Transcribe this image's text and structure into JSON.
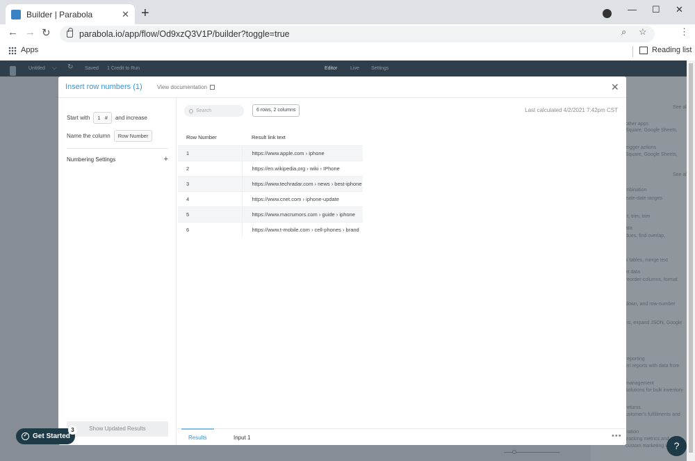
{
  "browser": {
    "tab_title": "Builder | Parabola",
    "tab_close": "✕",
    "new_tab": "+",
    "url": "parabola.io/app/flow/Od9xzQ3V1P/builder?toggle=true",
    "bookmarks": {
      "apps": "Apps",
      "reading_list": "Reading list"
    }
  },
  "appbar": {
    "flow_name": "Untitled",
    "saved": "Saved",
    "credits": "1 Credit to Run",
    "tabs": [
      "Editor",
      "Live",
      "Settings"
    ]
  },
  "side_panel": {
    "items": [
      "See all",
      "other apps",
      "Square, Google Sheets,",
      "trigger actions",
      "Square, Google Sheets,",
      "See all",
      "mbination",
      "eate-date ranges",
      "rt, trim, trim",
      "ata",
      "dues, find overlap,",
      "k tables, merge text",
      "xt data",
      "reorder-columns, format",
      "down, and row-number",
      "ns, expand JSON, Google",
      "reporting",
      "en reports with data from",
      "management",
      "solutions for bulk inventory",
      "returns",
      "ustomer's fulfillments and",
      "nation",
      "tracking metrics and",
      "custom marketing workflows"
    ]
  },
  "modal": {
    "title": "Insert row numbers (1)",
    "view_doc": "View documentation",
    "close": "✕",
    "settings": {
      "start_with_label": "Start with",
      "start_value": "1",
      "start_hash": "#",
      "and_increase": "and increase",
      "name_column_label": "Name the column",
      "column_name": "Row Number",
      "numbering_settings": "Numbering Settings",
      "plus": "+",
      "show_updated": "Show Updated Results"
    },
    "results": {
      "search_placeholder": "Search",
      "rows_badge": "6 rows, 2 columns",
      "last_calculated": "Last calculated 4/2/2021 7:42pm CST",
      "columns": [
        "Row Number",
        "Result link text"
      ],
      "rows": [
        [
          "1",
          "https://www.apple.com › iphone"
        ],
        [
          "2",
          "https://en.wikipedia.org › wiki › IPhone"
        ],
        [
          "3",
          "https://www.techradar.com › news › best-iphone"
        ],
        [
          "4",
          "https://www.cnet.com › iphone-update"
        ],
        [
          "5",
          "https://www.macrumors.com › guide › iphone"
        ],
        [
          "6",
          "https://www.t-mobile.com › cell-phones › brand"
        ]
      ]
    },
    "bottom_tabs": {
      "results": "Results",
      "input": "Input 1",
      "more": "•••"
    }
  },
  "get_started": {
    "label": "Get Started",
    "badge": "3"
  },
  "help": "?"
}
